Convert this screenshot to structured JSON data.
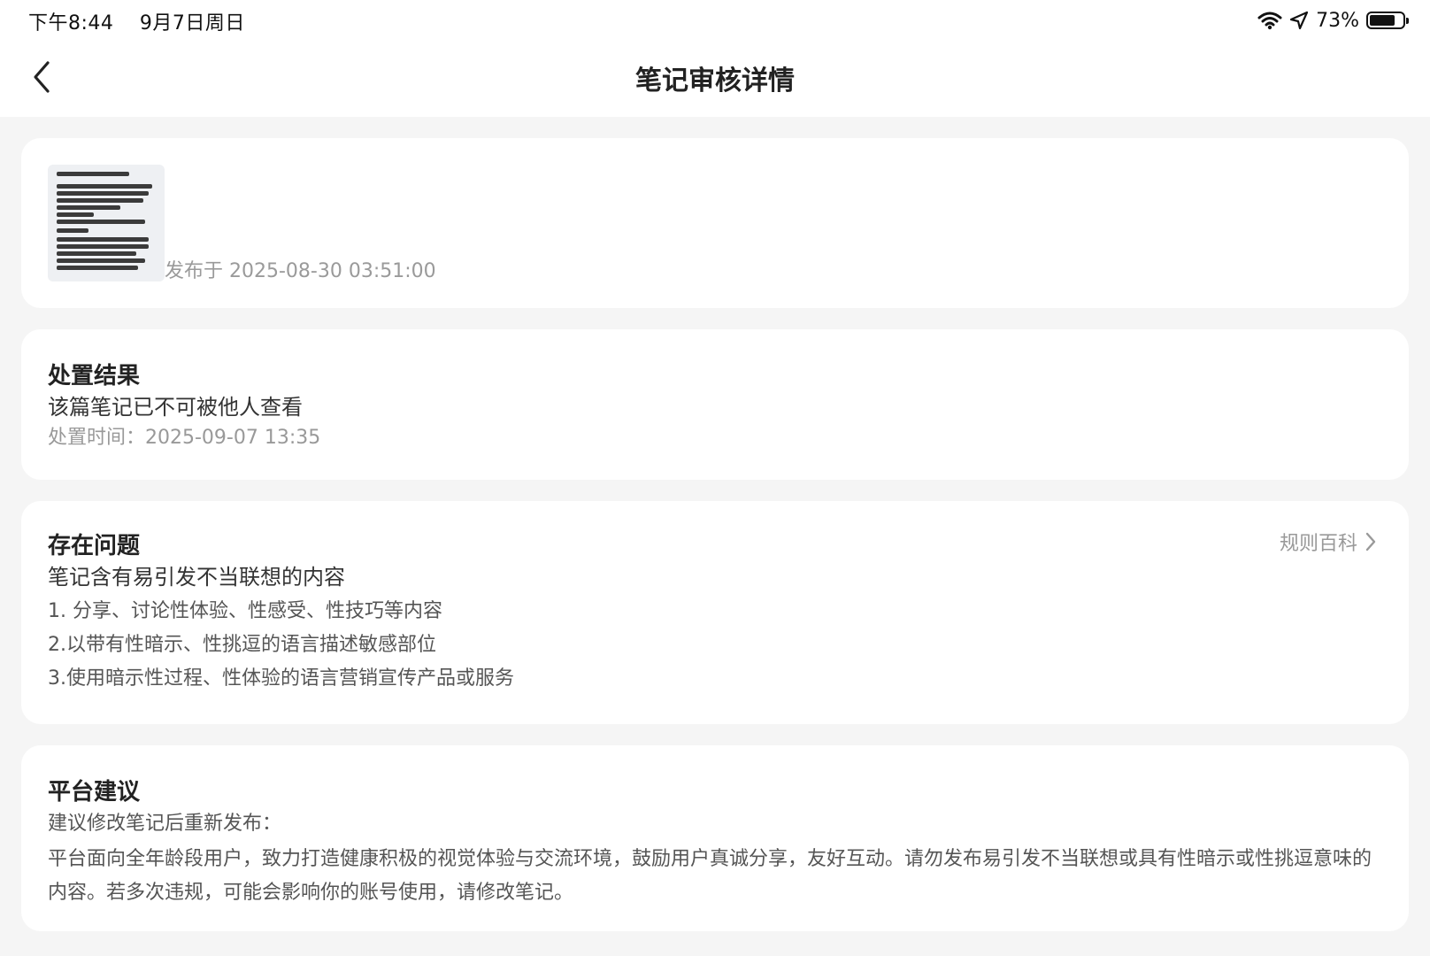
{
  "status_bar": {
    "time": "下午8:44",
    "date": "9月7日周日",
    "battery": "73%",
    "icons": [
      "wifi-icon",
      "location-arrow-icon",
      "battery-icon"
    ]
  },
  "nav": {
    "title": "笔记审核详情",
    "back_icon": "chevron-left-icon"
  },
  "note": {
    "published_at": "发布于 2025-08-30 03:51:00"
  },
  "result": {
    "title": "处置结果",
    "status": "该篇笔记已不可被他人查看",
    "time": "处置时间：2025-09-07 13:35"
  },
  "issue": {
    "title": "存在问题",
    "link_label": "规则百科",
    "summary": "笔记含有易引发不当联想的内容",
    "items": [
      "1. 分享、讨论性体验、性感受、性技巧等内容",
      "2.以带有性暗示、性挑逗的语言描述敏感部位",
      "3.使用暗示性过程、性体验的语言营销宣传产品或服务"
    ]
  },
  "advice": {
    "title": "平台建议",
    "intro": "建议修改笔记后重新发布：",
    "body": "平台面向全年龄段用户，致力打造健康积极的视觉体验与交流环境，鼓励用户真诚分享，友好互动。请勿发布易引发不当联想或具有性暗示或性挑逗意味的内容。若多次违规，可能会影响你的账号使用，请修改笔记。"
  }
}
